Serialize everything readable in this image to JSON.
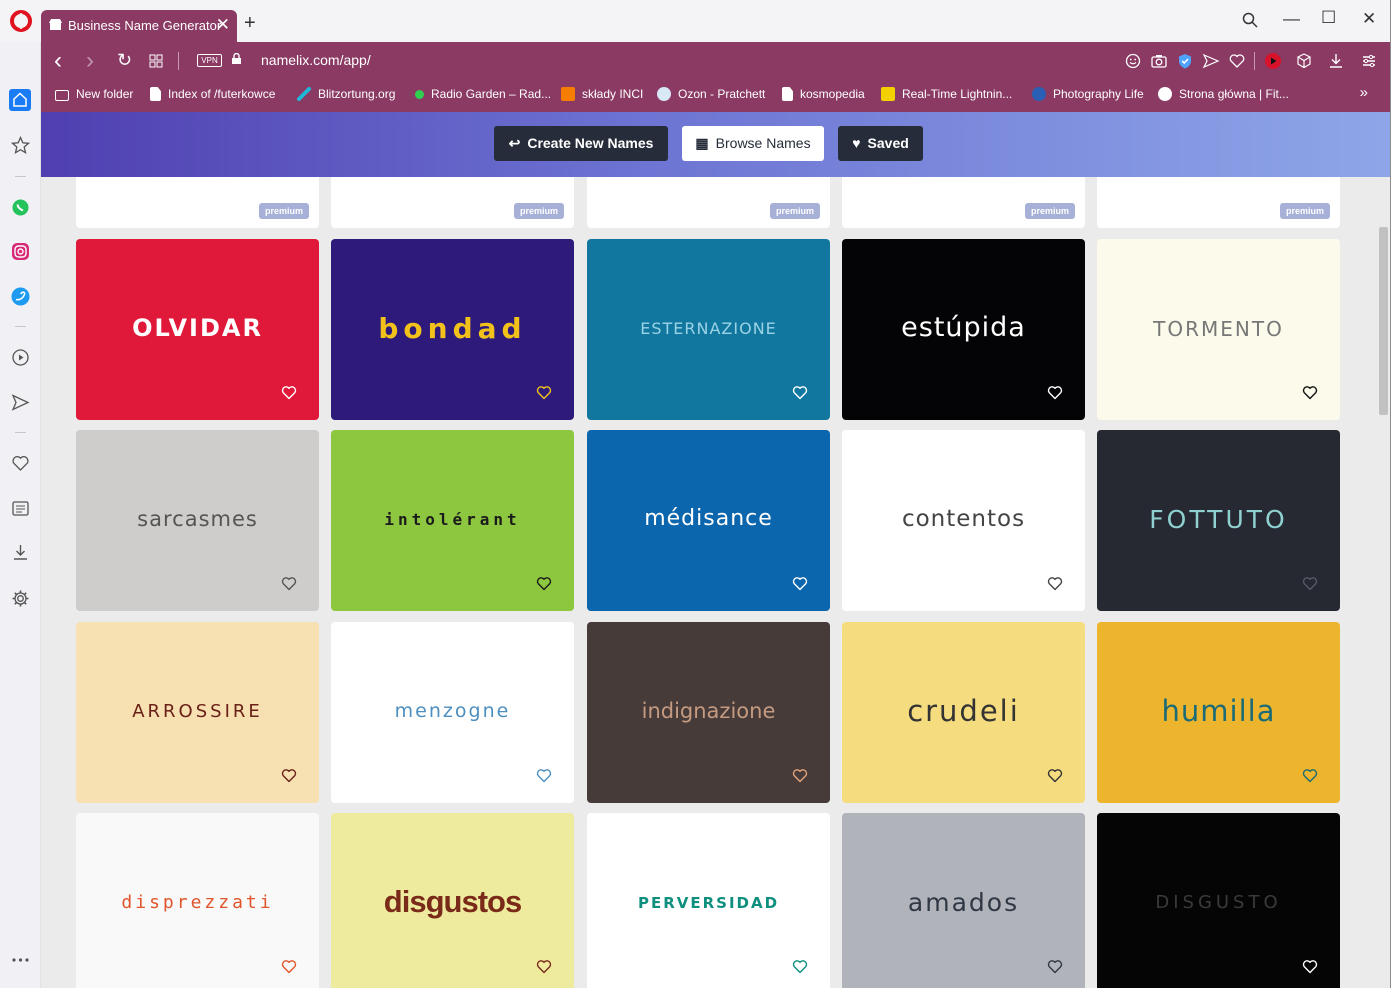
{
  "browser": {
    "tab_title": "Business Name Generator",
    "new_tab": "+",
    "tab_close": "✕",
    "url": "namelix.com/app/",
    "vpn": "VPN",
    "window": {
      "minimize": "—",
      "maximize": "☐",
      "close": "✕"
    },
    "nav": {
      "back": "‹",
      "forward": "›",
      "reload": "↻"
    }
  },
  "bookmarks": [
    {
      "label": "New folder",
      "icon": "folder-icon",
      "color": "#ffffff"
    },
    {
      "label": "Index of /futerkowce",
      "icon": "page-icon",
      "color": "#ffffff"
    },
    {
      "label": "Blitzortung.org",
      "icon": "lightning-line-icon",
      "color": "#1fb7d5"
    },
    {
      "label": "Radio Garden – Rad...",
      "icon": "green-dot-icon",
      "color": "#2dd04f"
    },
    {
      "label": "składy INCI",
      "icon": "blogger-icon",
      "color": "#f57d00"
    },
    {
      "label": "Ozon - Pratchett",
      "icon": "ozon-icon",
      "color": "#d9e8f5"
    },
    {
      "label": "kosmopedia",
      "icon": "page-icon",
      "color": "#ffffff"
    },
    {
      "label": "Real-Time Lightnin...",
      "icon": "bolt-icon",
      "color": "#f3d100"
    },
    {
      "label": "Photography Life",
      "icon": "pl-icon",
      "color": "#2a5fb5"
    },
    {
      "label": "Strona główna | Fit...",
      "icon": "gear-badge-icon",
      "color": "#ffffff"
    }
  ],
  "bookmarks_more": "»",
  "header": {
    "create_label": "Create New Names",
    "browse_label": "Browse Names",
    "saved_label": "Saved",
    "create_icon": "↩",
    "browse_icon": "▦",
    "saved_icon": "♥"
  },
  "premium_label": "premium",
  "colors": {
    "browser_accent": "#8a3a63",
    "header_dark": "#262c3a"
  },
  "cards": [
    {
      "name": "OLVIDAR",
      "bg": "#e0193a",
      "fg": "#ffffff",
      "heart": "#ffffff"
    },
    {
      "name": "bondad",
      "bg": "#2d1a7a",
      "fg": "#f2c21b",
      "heart": "#f2c21b"
    },
    {
      "name": "ESTERNAZIONE",
      "bg": "#11779f",
      "fg": "#9bd3e6",
      "heart": "#ffffff"
    },
    {
      "name": "estúpida",
      "bg": "#040406",
      "fg": "#ffffff",
      "heart": "#ffffff"
    },
    {
      "name": "TORMENTO",
      "bg": "#fcfaeb",
      "fg": "#777777",
      "heart": "#111111"
    },
    {
      "name": "sarcasmes",
      "bg": "#cecdcb",
      "fg": "#555555",
      "heart": "#555555"
    },
    {
      "name": "intolérant",
      "bg": "#8dc63f",
      "fg": "#1b1b1b",
      "heart": "#1b1b1b"
    },
    {
      "name": "médisance",
      "bg": "#0c66ad",
      "fg": "#ffffff",
      "heart": "#ffffff"
    },
    {
      "name": "contentos",
      "bg": "#ffffff",
      "fg": "#444444",
      "heart": "#444444"
    },
    {
      "name": "FOTTUTO",
      "bg": "#262932",
      "fg": "#8fd1d0",
      "heart": "#555a66"
    },
    {
      "name": "ARROSSIRE",
      "bg": "#f7e0b2",
      "fg": "#6a2016",
      "heart": "#6a2016"
    },
    {
      "name": "menzogne",
      "bg": "#ffffff",
      "fg": "#4d8fbf",
      "heart": "#4d8fbf"
    },
    {
      "name": "indignazione",
      "bg": "#463b39",
      "fg": "#c49a80",
      "heart": "#e3a37c"
    },
    {
      "name": "crudeli",
      "bg": "#f5dd7f",
      "fg": "#333333",
      "heart": "#333333"
    },
    {
      "name": "humilla",
      "bg": "#ecb52d",
      "fg": "#1c6b76",
      "heart": "#1c6b76"
    },
    {
      "name": "disprezzati",
      "bg": "#f9f9f9",
      "fg": "#e0552b",
      "heart": "#e0552b"
    },
    {
      "name": "disgustos",
      "bg": "#eeeb9e",
      "fg": "#7a2a19",
      "heart": "#7a2a19"
    },
    {
      "name": "PERVERSIDAD",
      "bg": "#ffffff",
      "fg": "#0f8f7e",
      "heart": "#0f8f7e"
    },
    {
      "name": "amados",
      "bg": "#b0b4ba",
      "fg": "#2f3844",
      "heart": "#2f3844"
    },
    {
      "name": "DISGUSTO",
      "bg": "#050505",
      "fg": "#3a3a3a",
      "heart": "#ffffff"
    }
  ]
}
